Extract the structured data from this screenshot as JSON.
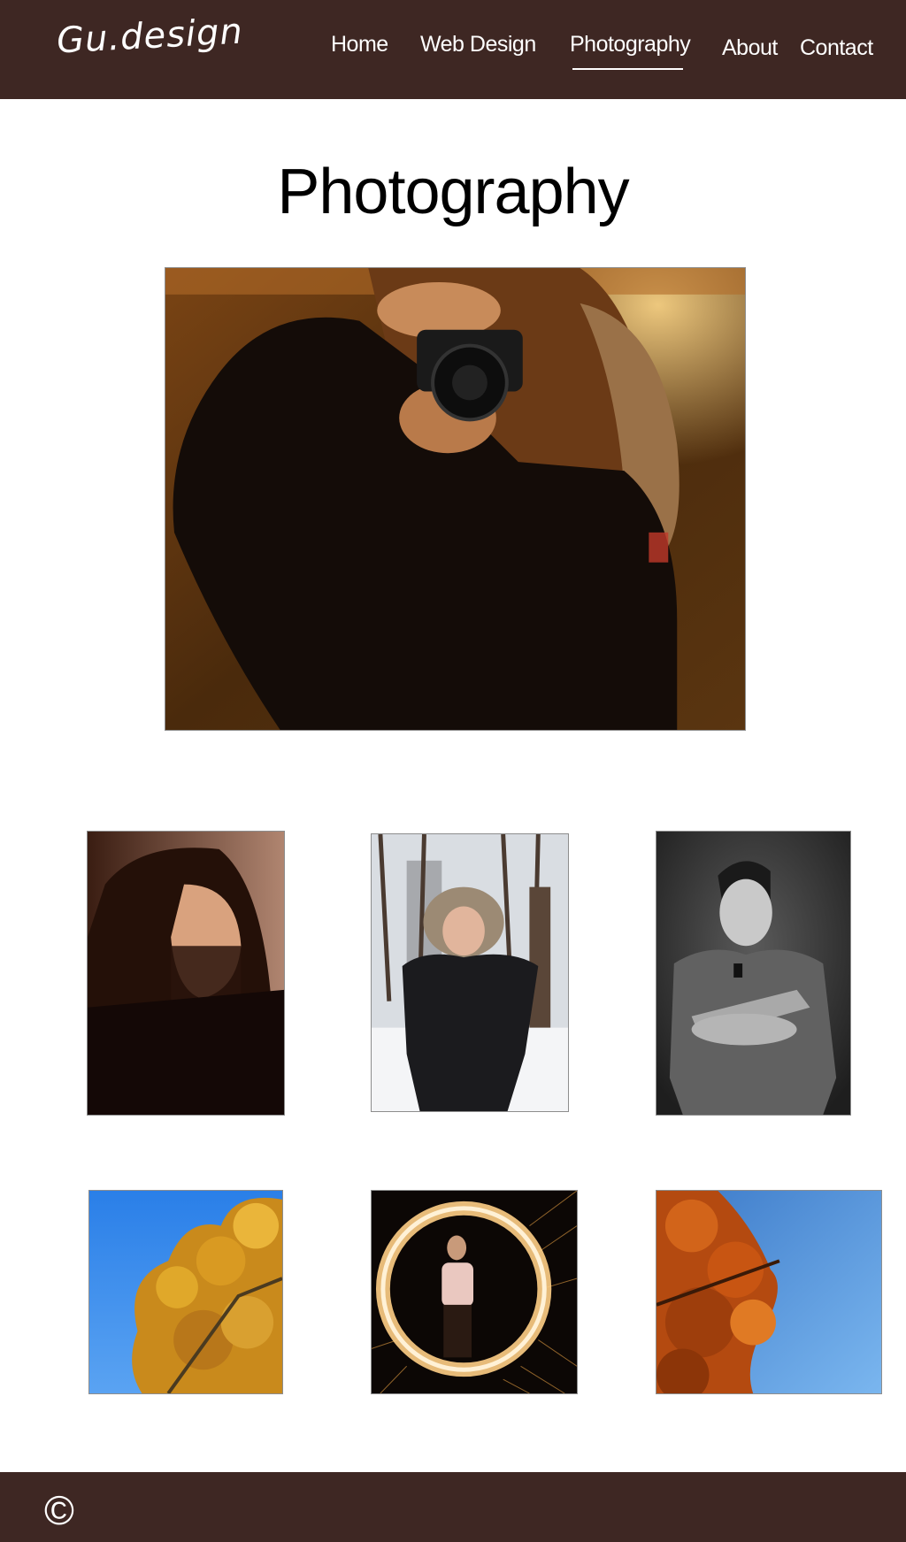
{
  "header": {
    "logo": "Gu.design",
    "background": "#3e2723",
    "nav": [
      {
        "label": "Home",
        "active": false
      },
      {
        "label": "Web Design",
        "active": false
      },
      {
        "label": "Photography",
        "active": true
      },
      {
        "label": "About",
        "active": false
      },
      {
        "label": "Contact",
        "active": false
      }
    ]
  },
  "main": {
    "title": "Photography"
  },
  "footer": {
    "copyright": "©",
    "background": "#3e2723"
  }
}
